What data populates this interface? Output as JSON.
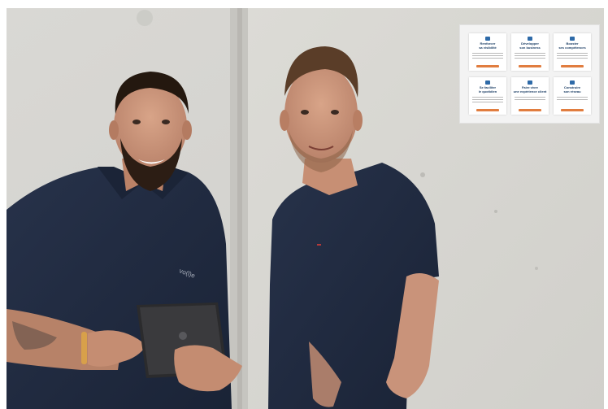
{
  "photo": {
    "description_icon": "two-men-photo",
    "colors": {
      "wall": "#d7d6d2",
      "shirt": "#1f2a3f",
      "skin": "#c99478",
      "hair": "#2a1d16",
      "tablet": "#2b2b2d"
    },
    "shirt_logo": "vo(l)e"
  },
  "overlay": {
    "tiles": [
      {
        "title": "Renforcer\nsa visibilité",
        "icon": "eye-icon"
      },
      {
        "title": "Développer\nson business",
        "icon": "users-icon"
      },
      {
        "title": "Booster\nses compétences",
        "icon": "chart-icon"
      },
      {
        "title": "Se faciliter\nle quotidien",
        "icon": "thumb-icon"
      },
      {
        "title": "Faire vivre\nune expérience client",
        "icon": "person-icon"
      },
      {
        "title": "Construire\nson réseau",
        "icon": "network-icon"
      }
    ],
    "colors": {
      "accent": "#e17d3f",
      "title": "#1d3f66",
      "icon": "#2e6aa8"
    }
  }
}
